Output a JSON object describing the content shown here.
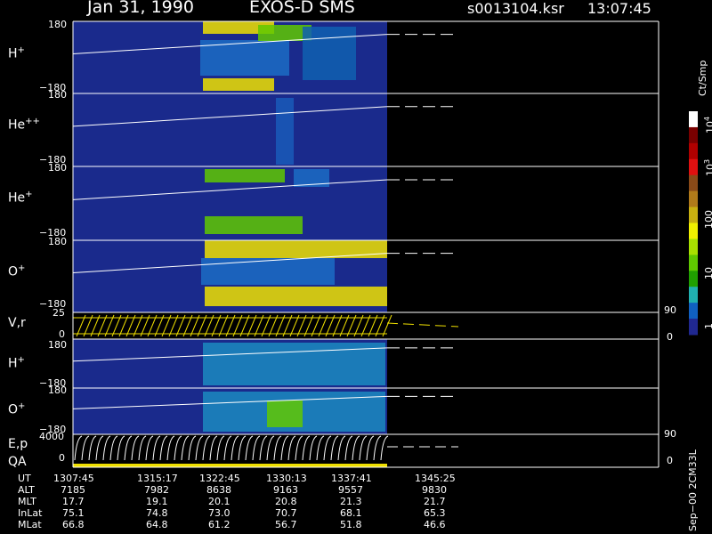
{
  "header": {
    "date": "Jan 31, 1990",
    "instrument": "EXOS-D SMS",
    "file": "s0013104.ksr",
    "time": "13:07:45"
  },
  "panels": [
    {
      "id": "h1",
      "label": "H",
      "sup": "+",
      "ymax": "180",
      "ymin": "−180"
    },
    {
      "id": "hepp",
      "label": "He",
      "sup": "++",
      "ymax": "180",
      "ymin": "−180"
    },
    {
      "id": "hep",
      "label": "He",
      "sup": "+",
      "ymax": "180",
      "ymin": "−180"
    },
    {
      "id": "op1",
      "label": "O",
      "sup": "+",
      "ymax": "180",
      "ymin": "−180"
    },
    {
      "id": "vr",
      "label": "V,r",
      "ymax": "25",
      "ymin": "0",
      "rmax": "90",
      "rmin": "0"
    },
    {
      "id": "h2",
      "label": "H",
      "sup": "+",
      "ymax": "180",
      "ymin": "−180"
    },
    {
      "id": "op2",
      "label": "O",
      "sup": "+",
      "ymax": "180",
      "ymin": "−180"
    },
    {
      "id": "ep",
      "label": "E,p",
      "label2": "QA",
      "ymax": "4000",
      "ymin": "0",
      "rmax": "90",
      "rmin": "0"
    }
  ],
  "colorbar": {
    "unit": "Ct/Smp",
    "labels": [
      {
        "base": "10",
        "exp": "4"
      },
      {
        "base": "10",
        "exp": "3"
      },
      {
        "text": "100"
      },
      {
        "text": "10"
      },
      {
        "text": "1"
      }
    ],
    "colors": [
      "#ffffff",
      "#7a0000",
      "#b00000",
      "#e01010",
      "#8a4a18",
      "#b07a1a",
      "#c8b010",
      "#f0f000",
      "#a8e000",
      "#60c800",
      "#20a000",
      "#20b0b0",
      "#1060c0",
      "#202890"
    ]
  },
  "ephemeris": {
    "rows": [
      {
        "name": "UT",
        "values": [
          "1307:45",
          "1315:17",
          "1322:45",
          "1330:13",
          "1337:41",
          "1345:25"
        ]
      },
      {
        "name": "ALT",
        "values": [
          "7185",
          "7982",
          "8638",
          "9163",
          "9557",
          "9830"
        ]
      },
      {
        "name": "MLT",
        "values": [
          "17.7",
          "19.1",
          "20.1",
          "20.8",
          "21.3",
          "21.7"
        ]
      },
      {
        "name": "InLat",
        "values": [
          "75.1",
          "74.8",
          "73.0",
          "70.7",
          "68.1",
          "65.3"
        ]
      },
      {
        "name": "MLat",
        "values": [
          "66.8",
          "64.8",
          "61.2",
          "56.7",
          "51.8",
          "46.6"
        ]
      }
    ]
  },
  "footer": "Sep−00 2CM33L",
  "chart_data": {
    "type": "heatmap",
    "title": "Jan 31, 1990   EXOS-D SMS",
    "x_ticks_ut": [
      "1307:45",
      "1315:17",
      "1322:45",
      "1330:13",
      "1337:41",
      "1345:25"
    ],
    "color_scale": "log counts 1 to 10^4 (Ct/Smp)",
    "series": [
      {
        "name": "H+",
        "ylim": [
          -180,
          180
        ]
      },
      {
        "name": "He++",
        "ylim": [
          -180,
          180
        ]
      },
      {
        "name": "He+",
        "ylim": [
          -180,
          180
        ]
      },
      {
        "name": "O+",
        "ylim": [
          -180,
          180
        ]
      },
      {
        "name": "V,r",
        "ylim": [
          0,
          25
        ],
        "right_ylim": [
          0,
          90
        ]
      },
      {
        "name": "H+",
        "ylim": [
          -180,
          180
        ]
      },
      {
        "name": "O+",
        "ylim": [
          -180,
          180
        ]
      },
      {
        "name": "E,p",
        "ylim": [
          0,
          4000
        ],
        "right_ylim": [
          0,
          90
        ]
      }
    ]
  }
}
